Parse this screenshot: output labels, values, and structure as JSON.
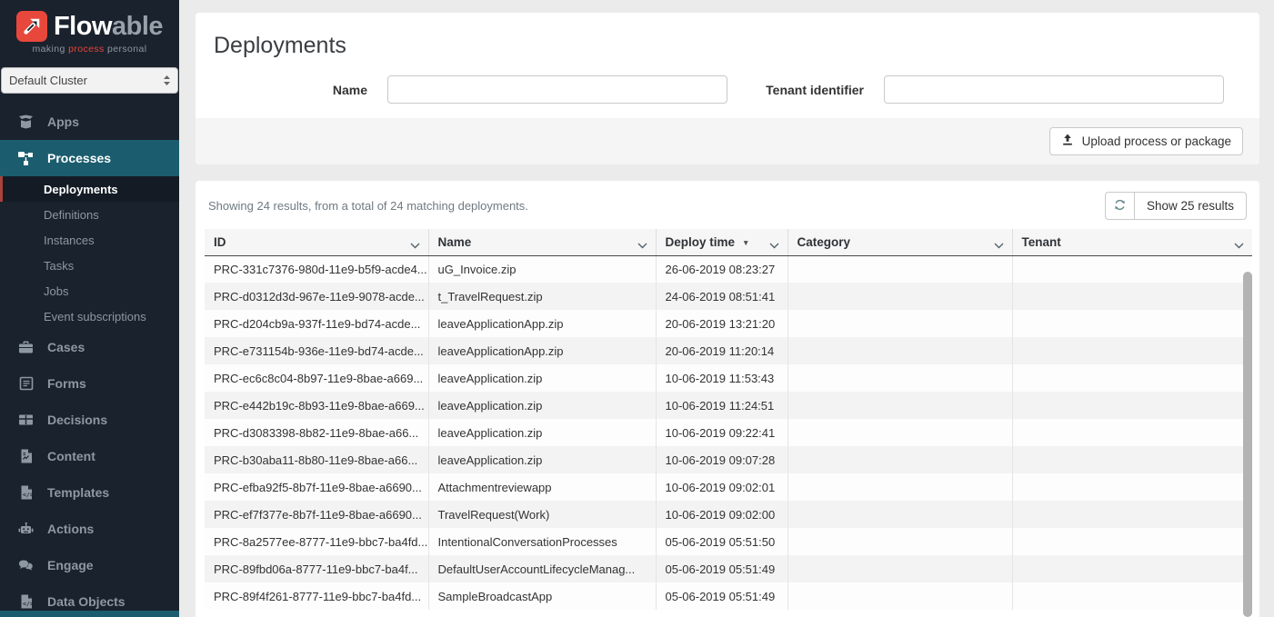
{
  "colors": {
    "accent_red": "#e8473b",
    "teal": "#1b5d6e",
    "sidebar_bg": "#1a222d",
    "active_subitem_bg": "#141b25"
  },
  "icons": {
    "logo": "arrow-up-right",
    "cluster": "up-down-arrows",
    "upload": "upload-arrow",
    "refresh": "circular-arrows",
    "sort": "▼",
    "column_menu": "chevron-down"
  },
  "sidebar": {
    "brand": {
      "flow": "Flow",
      "able": "able",
      "tagline_before": "making ",
      "tagline_accent": "process",
      "tagline_after": " personal"
    },
    "cluster": "Default Cluster",
    "nav_apps": "Apps",
    "nav_processes": "Processes",
    "sub": [
      "Deployments",
      "Definitions",
      "Instances",
      "Tasks",
      "Jobs",
      "Event subscriptions"
    ],
    "nav_rest": [
      "Cases",
      "Forms",
      "Decisions",
      "Content",
      "Templates",
      "Actions",
      "Engage",
      "Data Objects"
    ]
  },
  "header": {
    "title": "Deployments",
    "name_label": "Name",
    "tenant_label": "Tenant identifier",
    "upload_button": "Upload process or package"
  },
  "inputs": {
    "name_value": "",
    "tenant_value": ""
  },
  "results": {
    "summary": "Showing 24 results, from a total of 24 matching deployments.",
    "show_button": "Show 25 results"
  },
  "table": {
    "columns": [
      "ID",
      "Name",
      "Deploy time",
      "Category",
      "Tenant"
    ],
    "sorted_column": "Deploy time",
    "sort_direction": "desc",
    "rows": [
      {
        "id": "PRC-331c7376-980d-11e9-b5f9-acde4...",
        "name": "uG_Invoice.zip",
        "deploy_time": "26-06-2019 08:23:27",
        "category": "",
        "tenant": ""
      },
      {
        "id": "PRC-d0312d3d-967e-11e9-9078-acde...",
        "name": "t_TravelRequest.zip",
        "deploy_time": "24-06-2019 08:51:41",
        "category": "",
        "tenant": ""
      },
      {
        "id": "PRC-d204cb9a-937f-11e9-bd74-acde...",
        "name": "leaveApplicationApp.zip",
        "deploy_time": "20-06-2019 13:21:20",
        "category": "",
        "tenant": ""
      },
      {
        "id": "PRC-e731154b-936e-11e9-bd74-acde...",
        "name": "leaveApplicationApp.zip",
        "deploy_time": "20-06-2019 11:20:14",
        "category": "",
        "tenant": ""
      },
      {
        "id": "PRC-ec6c8c04-8b97-11e9-8bae-a669...",
        "name": "leaveApplication.zip",
        "deploy_time": "10-06-2019 11:53:43",
        "category": "",
        "tenant": ""
      },
      {
        "id": "PRC-e442b19c-8b93-11e9-8bae-a669...",
        "name": "leaveApplication.zip",
        "deploy_time": "10-06-2019 11:24:51",
        "category": "",
        "tenant": ""
      },
      {
        "id": "PRC-d3083398-8b82-11e9-8bae-a66...",
        "name": "leaveApplication.zip",
        "deploy_time": "10-06-2019 09:22:41",
        "category": "",
        "tenant": ""
      },
      {
        "id": "PRC-b30aba11-8b80-11e9-8bae-a66...",
        "name": "leaveApplication.zip",
        "deploy_time": "10-06-2019 09:07:28",
        "category": "",
        "tenant": ""
      },
      {
        "id": "PRC-efba92f5-8b7f-11e9-8bae-a6690...",
        "name": "Attachmentreviewapp",
        "deploy_time": "10-06-2019 09:02:01",
        "category": "",
        "tenant": ""
      },
      {
        "id": "PRC-ef7f377e-8b7f-11e9-8bae-a6690...",
        "name": "TravelRequest(Work)",
        "deploy_time": "10-06-2019 09:02:00",
        "category": "",
        "tenant": ""
      },
      {
        "id": "PRC-8a2577ee-8777-11e9-bbc7-ba4fd...",
        "name": "IntentionalConversationProcesses",
        "deploy_time": "05-06-2019 05:51:50",
        "category": "",
        "tenant": ""
      },
      {
        "id": "PRC-89fbd06a-8777-11e9-bbc7-ba4f...",
        "name": "DefaultUserAccountLifecycleManag...",
        "deploy_time": "05-06-2019 05:51:49",
        "category": "",
        "tenant": ""
      },
      {
        "id": "PRC-89f4f261-8777-11e9-bbc7-ba4fd...",
        "name": "SampleBroadcastApp",
        "deploy_time": "05-06-2019 05:51:49",
        "category": "",
        "tenant": ""
      }
    ]
  }
}
